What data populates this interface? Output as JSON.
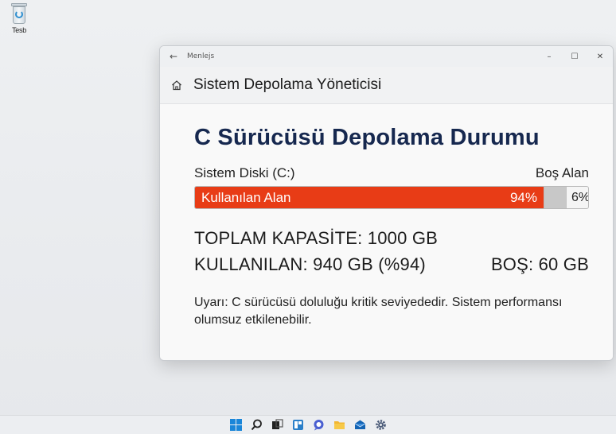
{
  "desktop": {
    "recycle_bin_label": "Tesb"
  },
  "window": {
    "app_title": "Menlejs",
    "back_glyph": "←",
    "minimize_glyph": "–",
    "maximize_glyph": "☐",
    "close_glyph": "✕",
    "header_title": "Sistem Depolama Yöneticisi"
  },
  "storage": {
    "title": "C Sürücüsü Depolama Durumu",
    "disk_label": "Sistem Diski (C:)",
    "free_label": "Boş Alan",
    "used_bar_label": "Kullanılan Alan",
    "used_percent_text": "94%",
    "free_percent_text": "6%",
    "used_fraction": 0.94,
    "total_text": "TOPLAM KAPASİTE: 1000 GB",
    "used_text": "KULLANILAN: 940 GB (%94)",
    "free_text": "BOŞ: 60 GB",
    "warning": "Uyarı: C sürücüsü doluluğu kritik seviyededir. Sistem performansı olumsuz etkilenebilir.",
    "used_color": "#e83c16"
  },
  "taskbar": {
    "icons": [
      "windows-start-icon",
      "search-icon",
      "task-view-icon",
      "widgets-icon",
      "chat-icon",
      "file-explorer-icon",
      "mail-icon",
      "settings-icon"
    ]
  }
}
